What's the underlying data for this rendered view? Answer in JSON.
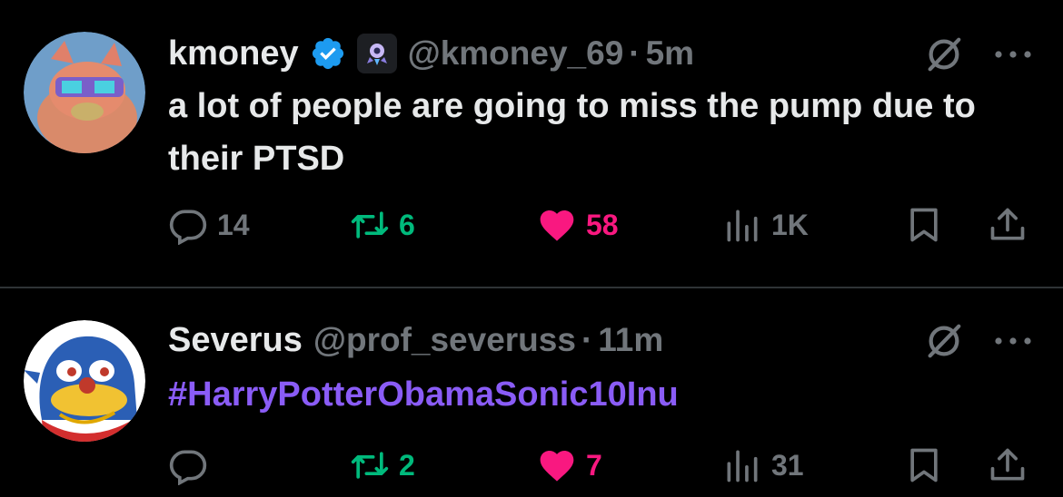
{
  "colors": {
    "background": "#000000",
    "text": "#e7e9ea",
    "muted": "#71767b",
    "verified": "#1d9bf0",
    "retweet": "#00ba7c",
    "like": "#f91880",
    "hashtag": "#8a5cf6"
  },
  "tweets": [
    {
      "name": "kmoney",
      "verified": true,
      "badge_icon": "rocket-badge-icon",
      "handle": "@kmoney_69",
      "separator": "·",
      "time": "5m",
      "text": "a lot of people are going to miss the pump due to their PTSD",
      "replies": "14",
      "retweets": "6",
      "likes": "58",
      "liked": true,
      "views": "1K"
    },
    {
      "name": "Severus",
      "verified": false,
      "handle": "@prof_severuss",
      "separator": "·",
      "time": "11m",
      "text": "#HarryPotterObamaSonic10Inu",
      "replies": "",
      "retweets": "2",
      "likes": "7",
      "liked": true,
      "views": "31"
    }
  ],
  "icons": [
    "grok-icon",
    "more-icon",
    "reply-icon",
    "retweet-icon",
    "heart-icon",
    "views-icon",
    "bookmark-icon",
    "share-icon"
  ]
}
